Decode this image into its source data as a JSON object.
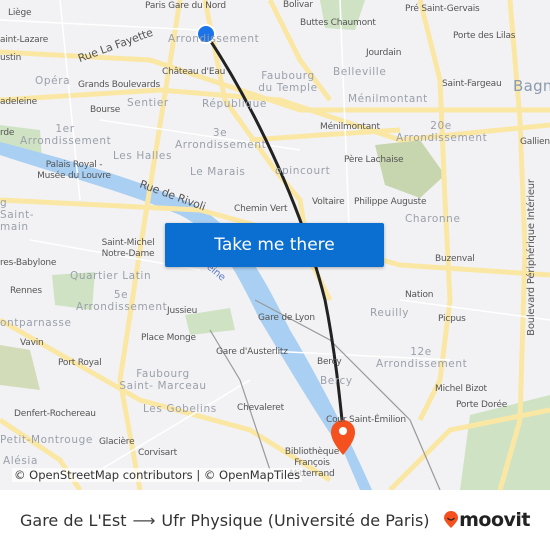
{
  "map": {
    "labels": [
      "Liège",
      "Paris Gare du Nord",
      "Bolivar",
      "Buttes Chaumont",
      "Pré Saint-Gervais",
      "aint-Lazare",
      "Rue La Fayette",
      "Arrondissement",
      "Porte des Lilas",
      "Jourdain",
      "ustin",
      "Château d'Eau",
      "Faubourg du Temple",
      "Belleville",
      "Opéra",
      "Grands Boulevards",
      "Saint-Fargeau",
      "Bagn",
      "adeleine",
      "Sentier",
      "République",
      "Ménilmontant",
      "Bourse",
      "1er Arrondissement",
      "3e Arrondissement",
      "Ménilmontant",
      "20e Arrondissement",
      "Gallieni",
      "rde",
      "Palais Royal - Musée du Louvre",
      "Les Halles",
      "Le Marais",
      "opincourt",
      "Père Lachaise",
      "Rue de Rivoli",
      "Chemin Vert",
      "Voltaire",
      "Philippe Auguste",
      "Charonne",
      "g Saint- main",
      "Saint-Michel Notre-Dame",
      "res-Babylone",
      "Buzenval",
      "Quartier Latin",
      "Rennes",
      "Nation",
      "5e Arrondissement",
      "Jussieu",
      "Gare de Lyon",
      "Reuilly",
      "Picpus",
      "ontparnasse",
      "Place Monge",
      "Vavin",
      "Gare d'Austerlitz",
      "12e Arrondissement",
      "Bercy",
      "Port Royal",
      "Faubourg Saint- Marceau",
      "Bercy",
      "Michel Bizot",
      "Denfert-Rochereau",
      "Les Gobelins",
      "Chevaleret",
      "Porte Dorée",
      "Cour Saint-Émilion",
      "Petit-Montrouge",
      "Glacière",
      "Corvisart",
      "Bibliothèque François Mitterrand",
      "Alésia",
      "Boulevard Périphérique Intérieur",
      "Seine"
    ],
    "attribution": "© OpenStreetMap contributors | © OpenMapTiles",
    "cta_label": "Take me there",
    "route_color": "#222222",
    "origin_color": "#1a73e8",
    "destination_color": "#f4511e"
  },
  "footer": {
    "origin": "Gare de L'Est",
    "arrow": "⟶",
    "destination": "Ufr Physique (Université de Paris)",
    "brand": "moovit",
    "brand_color": "#f4511e"
  }
}
